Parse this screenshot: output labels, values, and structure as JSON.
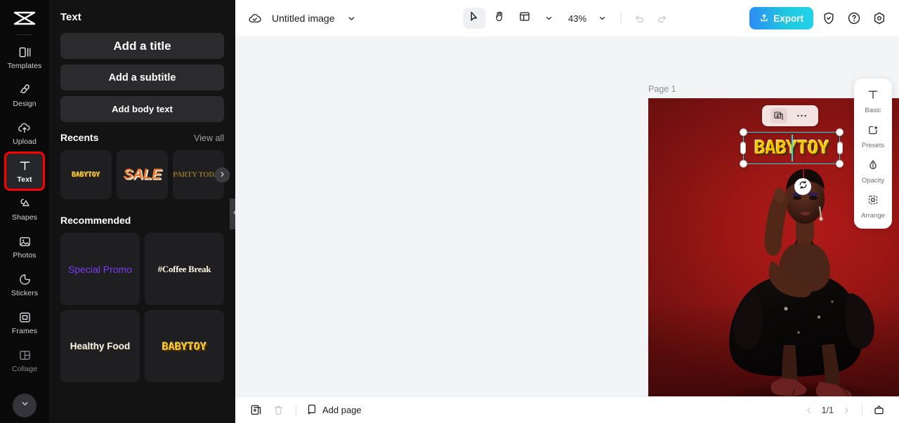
{
  "app": {
    "name": "CapCut",
    "logo_icon": "capcut-logo-icon"
  },
  "rail": {
    "items": [
      {
        "label": "Templates",
        "icon": "templates-icon"
      },
      {
        "label": "Design",
        "icon": "design-icon"
      },
      {
        "label": "Upload",
        "icon": "upload-cloud-icon"
      },
      {
        "label": "Text",
        "icon": "text-t-icon"
      },
      {
        "label": "Shapes",
        "icon": "shapes-icon"
      },
      {
        "label": "Photos",
        "icon": "photos-icon"
      },
      {
        "label": "Stickers",
        "icon": "stickers-icon"
      },
      {
        "label": "Frames",
        "icon": "frames-icon"
      },
      {
        "label": "Collage",
        "icon": "collage-icon"
      }
    ],
    "active_index": 3,
    "collapse_icon": "chevron-down-icon"
  },
  "panel": {
    "title": "Text",
    "add_buttons": [
      {
        "label": "Add a title"
      },
      {
        "label": "Add a subtitle"
      },
      {
        "label": "Add body text"
      }
    ],
    "recents": {
      "title": "Recents",
      "view_all": "View all",
      "next_icon": "chevron-right-icon",
      "items": [
        {
          "label": "BABYTOY"
        },
        {
          "label": "SALE"
        },
        {
          "label": "PARTY TODAY"
        }
      ]
    },
    "recommended": {
      "title": "Recommended",
      "items": [
        {
          "label": "Special Promo",
          "color": "#7c3cf5"
        },
        {
          "label": "#Coffee Break",
          "color": "#fff8e8"
        },
        {
          "label": "Healthy Food",
          "color": "#fffbe8"
        },
        {
          "label": "BABYTOY",
          "color": "#f5c518"
        }
      ]
    },
    "collapse_icon": "chevron-left-icon"
  },
  "topbar": {
    "cloud_icon": "cloud-check-icon",
    "doc_title": "Untitled image",
    "title_caret_icon": "chevron-down-icon",
    "tools": [
      {
        "name": "select-tool",
        "icon": "cursor-arrow-icon",
        "active": true
      },
      {
        "name": "hand-tool",
        "icon": "hand-icon",
        "active": false
      },
      {
        "name": "layout-tool",
        "icon": "layout-grid-icon",
        "active": false
      }
    ],
    "layout_caret_icon": "chevron-down-icon",
    "zoom_level": "43%",
    "zoom_caret_icon": "chevron-down-icon",
    "undo_icon": "undo-icon",
    "redo_icon": "redo-icon",
    "export_label": "Export",
    "export_icon": "upload-arrow-icon",
    "export_color": "#22c8e8",
    "right_icons": [
      {
        "name": "shield-check-icon"
      },
      {
        "name": "help-question-icon"
      },
      {
        "name": "settings-gear-icon"
      }
    ]
  },
  "canvas": {
    "page_label": "Page 1",
    "page_actions": [
      {
        "name": "duplicate-page-icon"
      },
      {
        "name": "more-options-icon"
      }
    ],
    "background_color": "#9d1715",
    "floating_toolbar": [
      {
        "name": "duplicate-element-icon"
      },
      {
        "name": "more-options-icon"
      }
    ],
    "selected_text": "BABYTOY",
    "selected_text_color": "#f7c400",
    "selection_color": "#26d7e8",
    "rotate_icon": "rotate-icon"
  },
  "right_panel": {
    "items": [
      {
        "label": "Basic",
        "icon": "text-t-icon"
      },
      {
        "label": "Presets",
        "icon": "presets-star-icon"
      },
      {
        "label": "Opacity",
        "icon": "opacity-droplet-icon"
      },
      {
        "label": "Arrange",
        "icon": "arrange-icon"
      }
    ]
  },
  "bottombar": {
    "duplicate_icon": "duplicate-page-icon",
    "delete_icon": "trash-icon",
    "add_page_label": "Add page",
    "add_page_icon": "add-page-icon",
    "prev_icon": "chevron-left-icon",
    "next_icon": "chevron-right-icon",
    "page_count": "1/1",
    "present_icon": "present-icon"
  }
}
